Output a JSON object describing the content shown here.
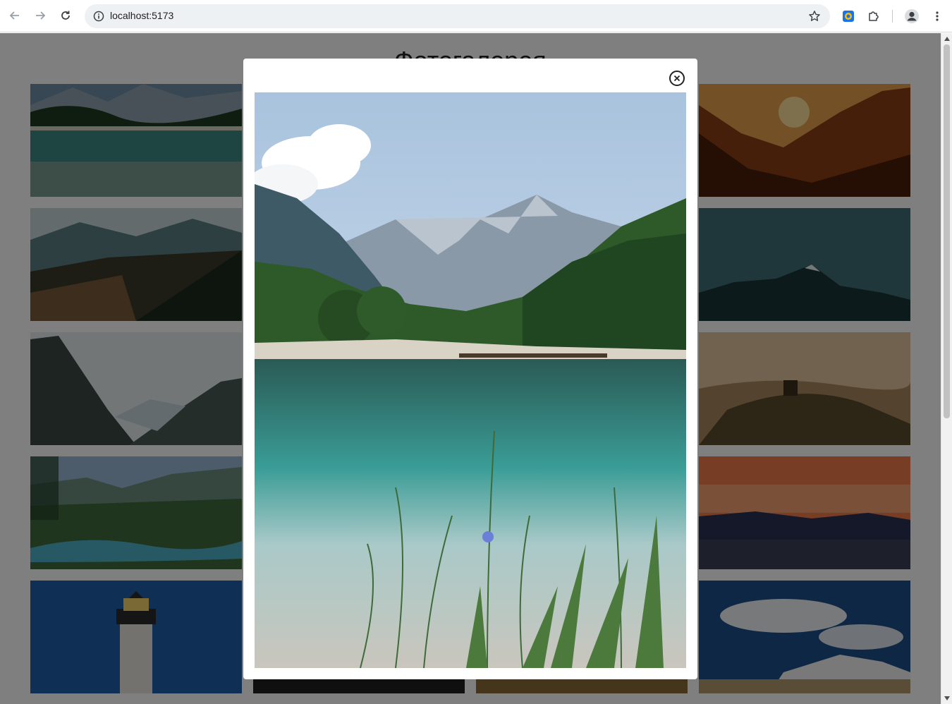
{
  "browser": {
    "url": "localhost:5173",
    "icons": {
      "back": "arrow-left-icon",
      "forward": "arrow-right-icon",
      "reload": "reload-icon",
      "site_info": "info-icon",
      "bookmark": "star-icon",
      "extension_1": "extension-colored-icon",
      "extensions": "puzzle-icon",
      "profile": "avatar-icon",
      "menu": "kebab-menu-icon"
    }
  },
  "page": {
    "title": "Фотогалерея",
    "overlay_color": "#000000",
    "thumbnails": [
      {
        "name": "lake-mountains-1"
      },
      {
        "name": "alpine-valley-lake"
      },
      {
        "name": "glacier-valley"
      },
      {
        "name": "mountain-river"
      },
      {
        "name": "lighthouse-night"
      },
      {
        "name": "sunset-mountains"
      },
      {
        "name": "dark-mountain-peaks"
      },
      {
        "name": "tuscany-hills"
      },
      {
        "name": "sunset-lake"
      },
      {
        "name": "snowy-volcano-clouds"
      },
      {
        "name": "bottom-dark"
      },
      {
        "name": "bottom-sand"
      }
    ]
  },
  "modal": {
    "close_icon": "close-icon",
    "photo": "lake-mountains-large"
  }
}
